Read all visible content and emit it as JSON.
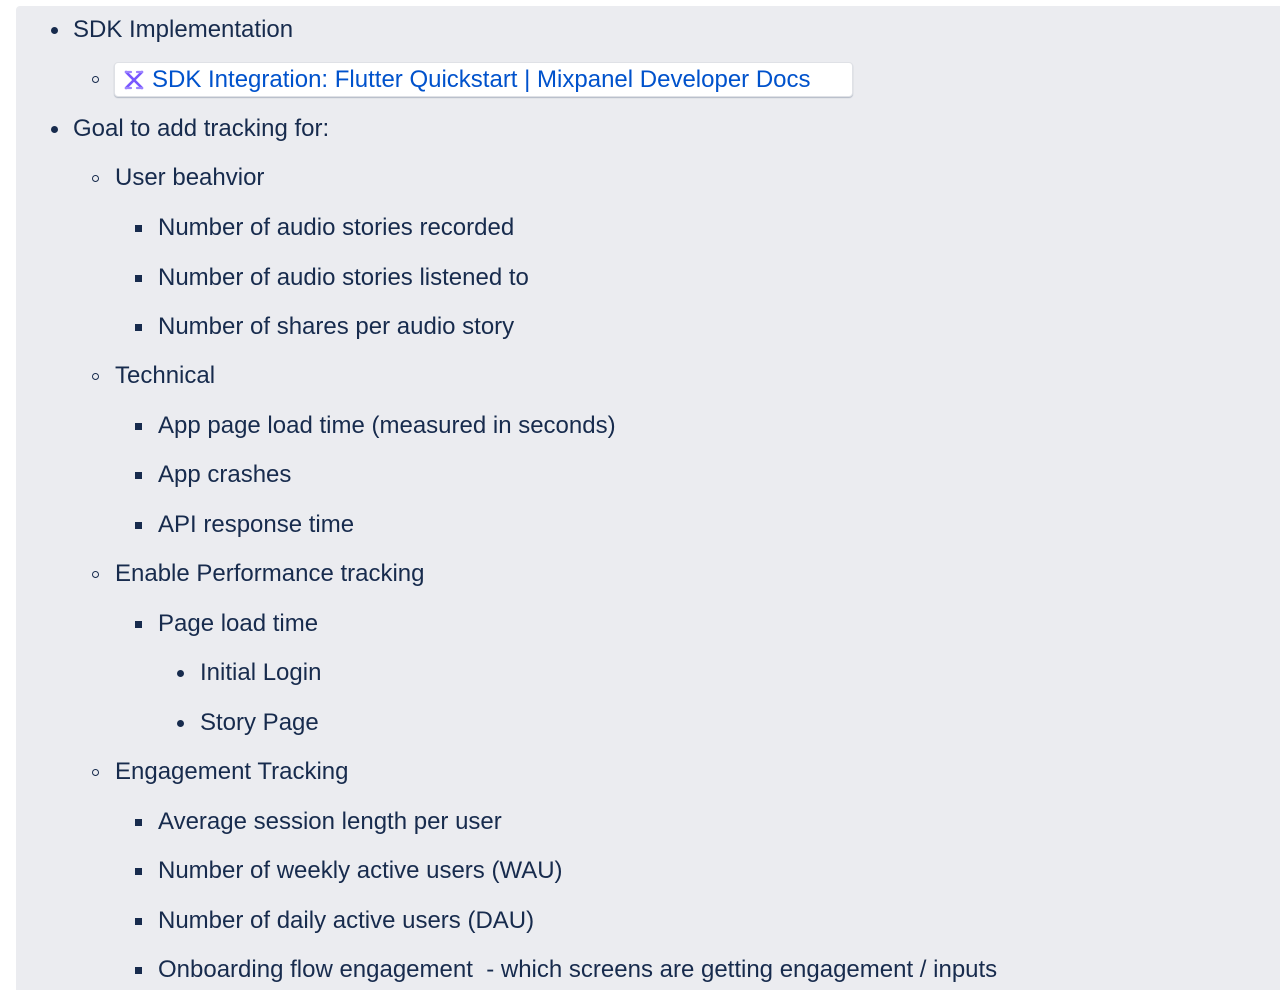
{
  "doc": {
    "items": [
      {
        "text": "SDK Implementation"
      },
      {
        "link": {
          "icon": "mixpanel-logo-icon",
          "text": "SDK Integration: Flutter Quickstart | Mixpanel Developer Docs",
          "color": "#0052cc"
        }
      },
      {
        "text": "Goal to add tracking for:"
      },
      {
        "text": "User beahvior"
      },
      {
        "text": "Number of audio stories recorded"
      },
      {
        "text": "Number of audio stories listened to"
      },
      {
        "text": "Number of shares per audio story"
      },
      {
        "text": "Technical"
      },
      {
        "text": "App page load time (measured in seconds)"
      },
      {
        "text": "App crashes"
      },
      {
        "text": "API response time"
      },
      {
        "text": "Enable Performance tracking"
      },
      {
        "text": "Page load time"
      },
      {
        "text": "Initial Login"
      },
      {
        "text": "Story Page"
      },
      {
        "text": "Engagement Tracking"
      },
      {
        "text": "Average session length per user"
      },
      {
        "text": "Number of weekly active users (WAU)"
      },
      {
        "text": "Number of daily active users (DAU)"
      },
      {
        "text": "Onboarding flow engagement  - which screens are getting engagement / inputs"
      }
    ]
  },
  "colors": {
    "text": "#172b4d",
    "link": "#0052cc",
    "panel": "#ebecf0",
    "icon": "#7856ff"
  }
}
